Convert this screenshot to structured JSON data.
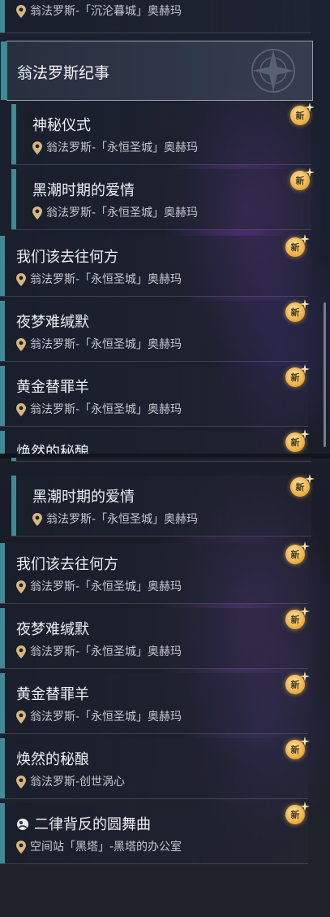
{
  "colors": {
    "accent_bar": "#3f8a95",
    "badge_gold": "#e8a83a",
    "text_main": "#eceff4"
  },
  "new_badge_text": "新",
  "top": {
    "partial_row": {
      "location": "翁法罗斯-「沉沦暮城」奥赫玛"
    },
    "section_header": {
      "title": "翁法罗斯纪事"
    },
    "rows": [
      {
        "title": "神秘仪式",
        "location": "翁法罗斯-「永恒圣城」奥赫玛"
      },
      {
        "title": "黑潮时期的爱情",
        "location": "翁法罗斯-「永恒圣城」奥赫玛"
      },
      {
        "title": "我们该去往何方",
        "location": "翁法罗斯-「永恒圣城」奥赫玛"
      },
      {
        "title": "夜梦难缄默",
        "location": "翁法罗斯-「永恒圣城」奥赫玛"
      },
      {
        "title": "黄金替罪羊",
        "location": "翁法罗斯-「永恒圣城」奥赫玛"
      },
      {
        "title": "焕然的秘酿",
        "location": ""
      }
    ]
  },
  "bottom": {
    "rows": [
      {
        "title": "黑潮时期的爱情",
        "location": "翁法罗斯-「永恒圣城」奥赫玛"
      },
      {
        "title": "我们该去往何方",
        "location": "翁法罗斯-「永恒圣城」奥赫玛"
      },
      {
        "title": "夜梦难缄默",
        "location": "翁法罗斯-「永恒圣城」奥赫玛"
      },
      {
        "title": "黄金替罪羊",
        "location": "翁法罗斯-「永恒圣城」奥赫玛"
      },
      {
        "title": "焕然的秘酿",
        "location": "翁法罗斯-创世涡心"
      },
      {
        "title": "二律背反的圆舞曲",
        "location": "空间站「黑塔」-黑塔的办公室"
      }
    ]
  }
}
